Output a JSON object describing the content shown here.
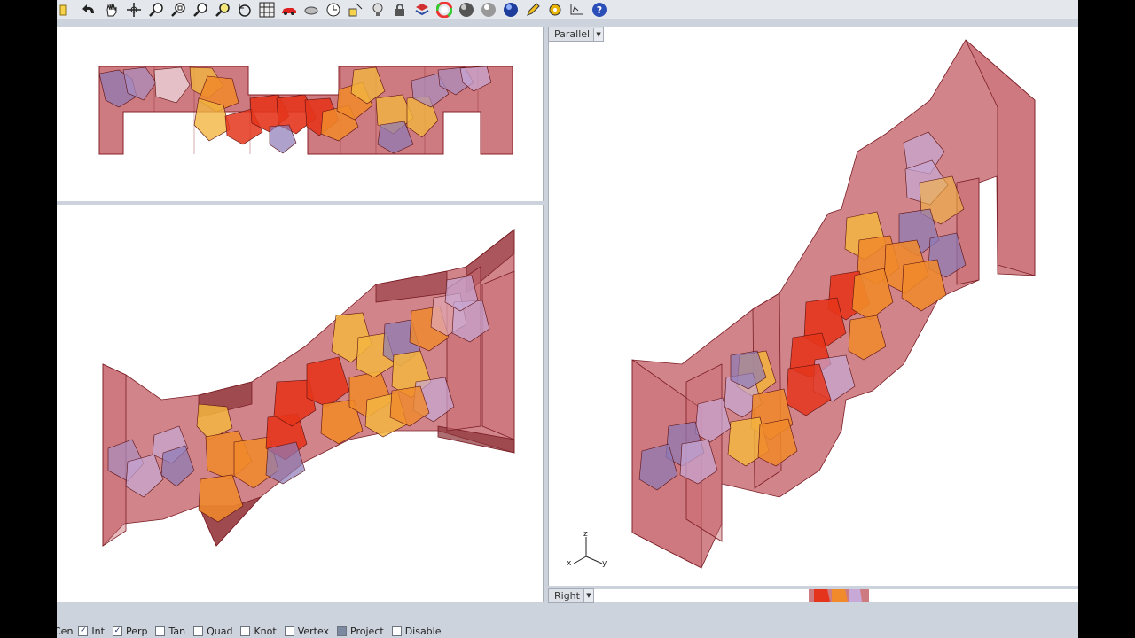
{
  "toolbar": {
    "tools": [
      {
        "name": "open-icon"
      },
      {
        "name": "undo-icon"
      },
      {
        "name": "pan-hand-icon"
      },
      {
        "name": "rotate-view-icon"
      },
      {
        "name": "zoom-icon"
      },
      {
        "name": "zoom-window-icon"
      },
      {
        "name": "zoom-extents-icon"
      },
      {
        "name": "zoom-selected-icon"
      },
      {
        "name": "rotate-icon"
      },
      {
        "name": "grid-icon"
      },
      {
        "name": "car-render-icon"
      },
      {
        "name": "lightbulb-render-icon"
      },
      {
        "name": "clock-icon"
      },
      {
        "name": "select-points-icon"
      },
      {
        "name": "light-icon"
      },
      {
        "name": "lock-icon"
      },
      {
        "name": "layer-icon"
      },
      {
        "name": "color-wheel-icon"
      },
      {
        "name": "material-sphere-icon"
      },
      {
        "name": "chrome-sphere-icon"
      },
      {
        "name": "blue-sphere-icon"
      },
      {
        "name": "pencil-icon"
      },
      {
        "name": "gear-settings-icon"
      },
      {
        "name": "dimension-icon"
      },
      {
        "name": "help-icon"
      }
    ]
  },
  "viewports": {
    "parallel_label": "Parallel",
    "right_label": "Right"
  },
  "axis": {
    "z": "z",
    "x": "x",
    "y": "y"
  },
  "statusbar": {
    "cen_label": "Cen",
    "snaps": [
      {
        "label": "Int",
        "checked": true
      },
      {
        "label": "Perp",
        "checked": true
      },
      {
        "label": "Tan",
        "checked": false
      },
      {
        "label": "Quad",
        "checked": false
      },
      {
        "label": "Knot",
        "checked": false
      },
      {
        "label": "Vertex",
        "checked": false
      },
      {
        "label": "Project",
        "checked": false
      },
      {
        "label": "Disable",
        "checked": false
      }
    ]
  },
  "colors": {
    "wall": "#b8434b",
    "orange": "#f08a2a",
    "red": "#e4351c",
    "purple": "#8c7bb8",
    "yellow": "#f3b540"
  }
}
